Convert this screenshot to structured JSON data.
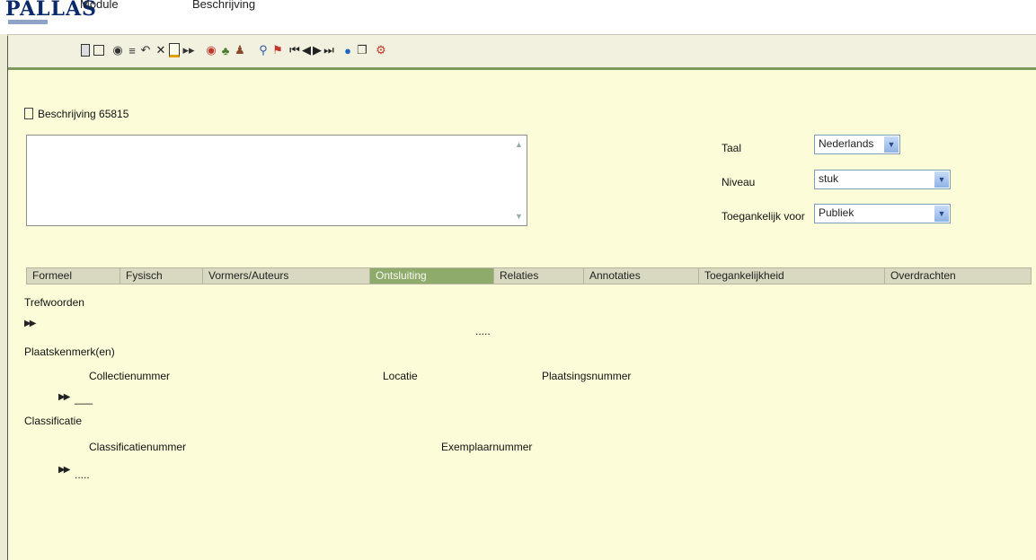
{
  "app": {
    "logo": "PALLAS",
    "menu": [
      "Module",
      "Beschrijving"
    ]
  },
  "toolbar": {
    "icons": [
      "form-icon",
      "window-icon",
      "binoculars-icon",
      "list-icon",
      "link-icon",
      "delete-icon",
      "document-icon",
      "forward-icon",
      "search-icon",
      "tree-icon",
      "person-icon",
      "zoom-icon",
      "flag-icon",
      "first-icon",
      "prev-icon",
      "next-icon",
      "last-icon",
      "globe-icon",
      "copy-icon",
      "help-icon"
    ]
  },
  "form": {
    "title": "Beschrijving 65815",
    "taal_label": "Taal",
    "taal_value": "Nederlands",
    "niveau_label": "Niveau",
    "niveau_value": "stuk",
    "toegankelijk_label": "Toegankelijk voor",
    "toegankelijk_value": "Publiek"
  },
  "tabs": [
    {
      "label": "Formeel",
      "active": false
    },
    {
      "label": "Fysisch",
      "active": false
    },
    {
      "label": "Vormers/Auteurs",
      "active": false
    },
    {
      "label": "Ontsluiting",
      "active": true
    },
    {
      "label": "Relaties",
      "active": false
    },
    {
      "label": "Annotaties",
      "active": false
    },
    {
      "label": "Toegankelijkheid",
      "active": false
    },
    {
      "label": "Overdrachten",
      "active": false
    }
  ],
  "content": {
    "trefwoorden": "Trefwoorden",
    "trefwoorden_dots": ".....",
    "plaatskenmerken": "Plaatskenmerk(en)",
    "collectienummer": "Collectienummer",
    "locatie": "Locatie",
    "plaatsingsnummer": "Plaatsingsnummer",
    "plaats_dash": "___",
    "classificatie": "Classificatie",
    "classificatienummer": "Classificatienummer",
    "exemplaarnummer": "Exemplaarnummer",
    "class_dots": "....."
  },
  "colors": {
    "background": "#fcfcd8",
    "active_tab": "#8eab6b",
    "toolbar_border": "#7e9a5b",
    "logo": "#0b2a6b"
  }
}
